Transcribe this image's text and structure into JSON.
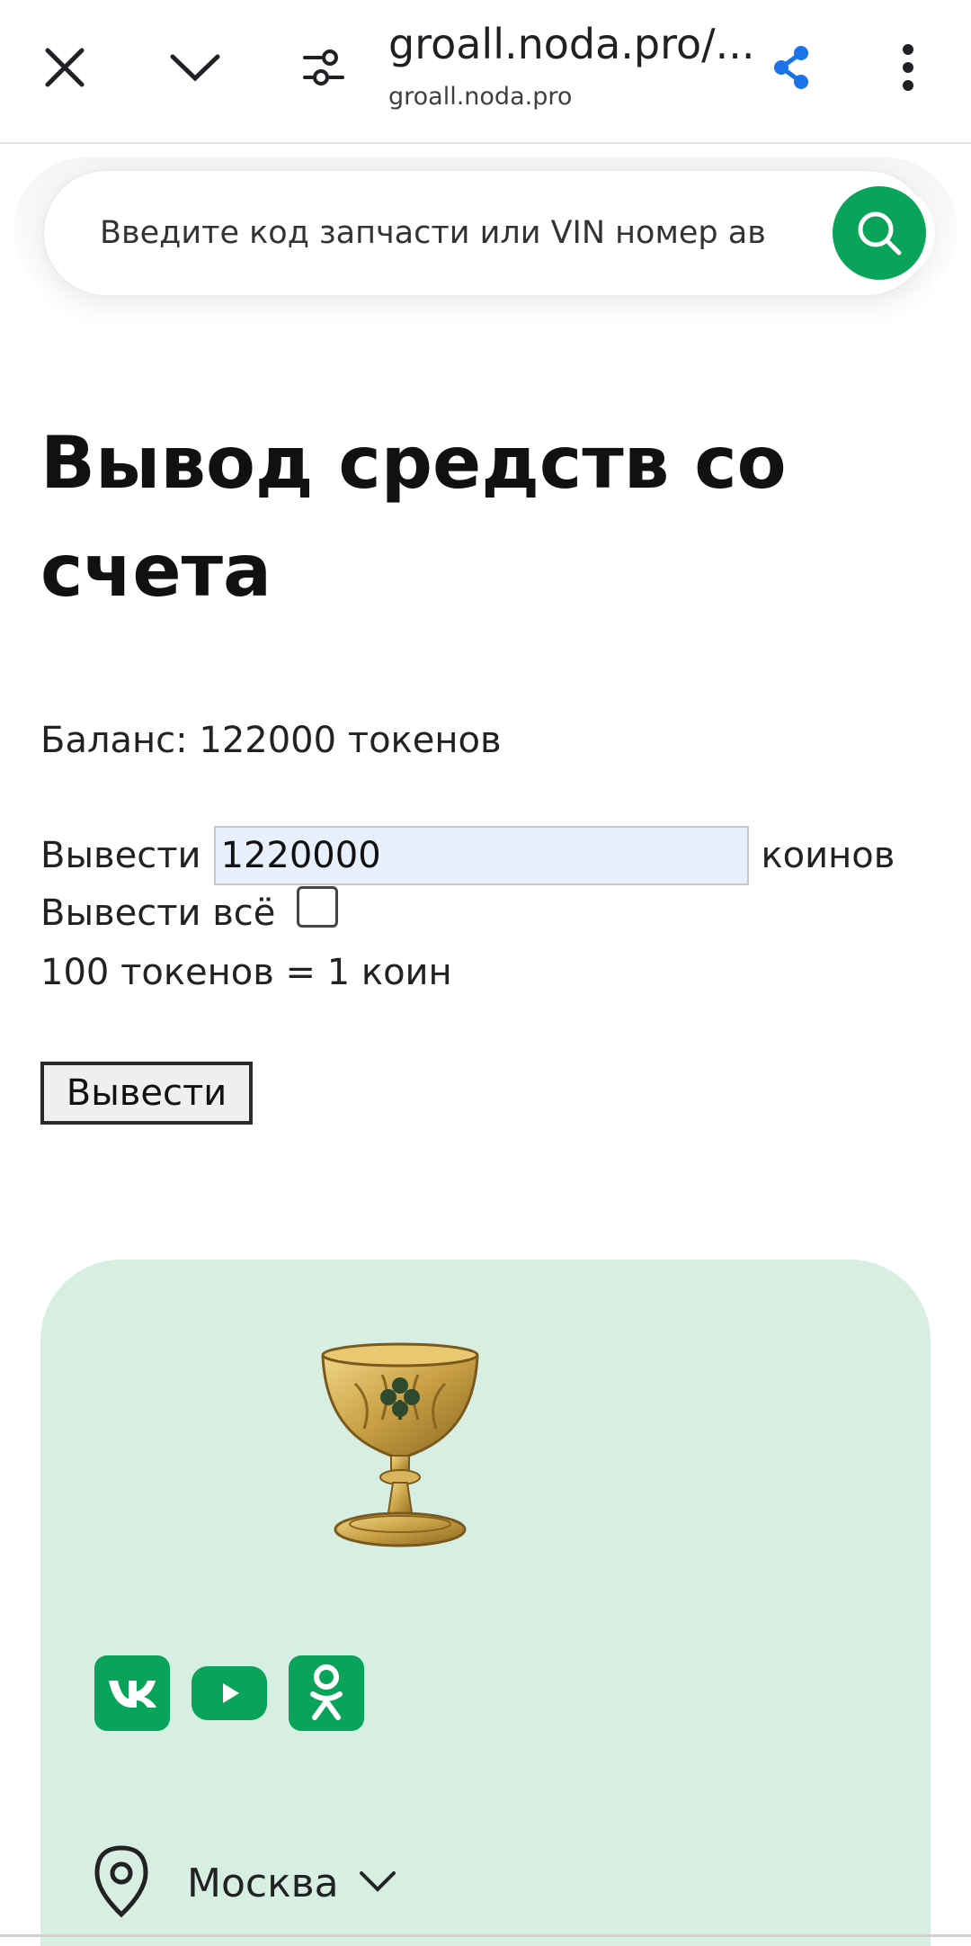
{
  "browser": {
    "url_title": "groall.noda.pro/...",
    "url_domain": "groall.noda.pro",
    "icons": [
      "close-icon",
      "chevron-down-icon",
      "tune-icon",
      "share-icon",
      "more-vert-icon"
    ],
    "share_color": "#1a73e8"
  },
  "search": {
    "placeholder": "Введите код запчасти или VIN номер ав",
    "button_color": "#0aa35a"
  },
  "main": {
    "title": "Вывод средств со счета",
    "balance": "Баланс: 122000 токенов",
    "withdraw_label": "Вывести",
    "withdraw_value": "1220000",
    "withdraw_unit": "коинов",
    "withdraw_all_label": "Вывести всё",
    "withdraw_all_checked": false,
    "rate": "100 токенов = 1 коин",
    "submit_label": "Вывести"
  },
  "footer": {
    "bg_color": "#d7efe3",
    "logo": "grail-chalice-logo",
    "socials": [
      "vk-icon",
      "youtube-icon",
      "odnoklassniki-icon"
    ],
    "city": "Москва"
  }
}
